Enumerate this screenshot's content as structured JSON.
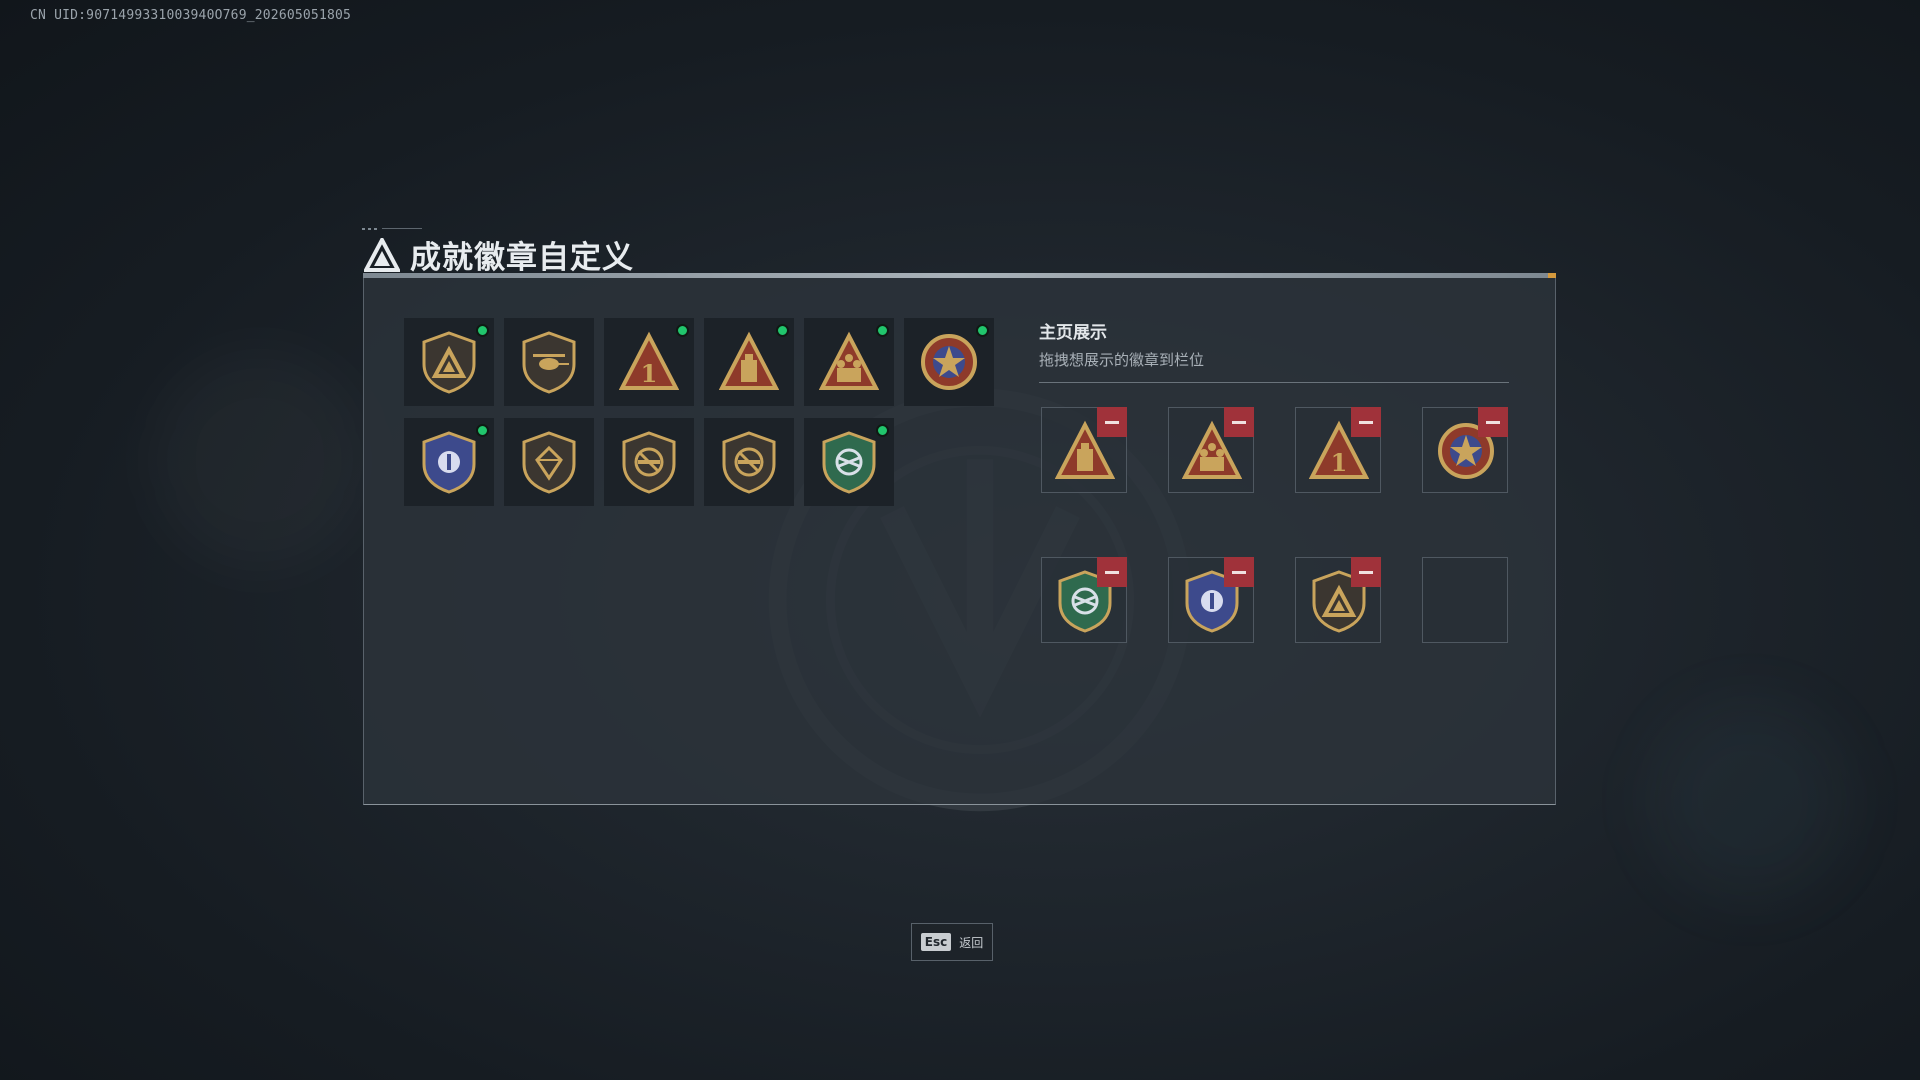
{
  "uid_text": "CN UID:9071499331003940O769_202605051805",
  "header": {
    "title": "成就徽章自定义",
    "logo_icon": "triangle-logo-icon"
  },
  "badges": [
    {
      "icon": "triangle-shield-badge",
      "new": true
    },
    {
      "icon": "helicopter-shield-badge",
      "new": false
    },
    {
      "icon": "number-one-triangle-badge",
      "new": true
    },
    {
      "icon": "tower-triangle-badge",
      "new": true
    },
    {
      "icon": "soldiers-triangle-badge",
      "new": true
    },
    {
      "icon": "star-crest-badge",
      "new": true
    },
    {
      "icon": "blue-winged-shield-badge",
      "new": true
    },
    {
      "icon": "diamond-shield-badge",
      "new": false
    },
    {
      "icon": "no-rifle-shield-badge",
      "new": false
    },
    {
      "icon": "no-pistol-shield-badge",
      "new": false
    },
    {
      "icon": "green-eagle-shield-badge",
      "new": true
    }
  ],
  "showcase": {
    "title": "主页展示",
    "subtitle": "拖拽想展示的徽章到栏位",
    "slots": [
      {
        "icon": "tower-triangle-badge",
        "filled": true
      },
      {
        "icon": "soldiers-triangle-badge",
        "filled": true
      },
      {
        "icon": "number-one-triangle-badge",
        "filled": true
      },
      {
        "icon": "star-crest-badge",
        "filled": true
      },
      {
        "icon": "green-eagle-shield-badge",
        "filled": true
      },
      {
        "icon": "blue-winged-shield-badge",
        "filled": true
      },
      {
        "icon": "triangle-shield-badge",
        "filled": true
      },
      {
        "icon": "",
        "filled": false
      }
    ]
  },
  "esc": {
    "key": "Esc",
    "label": "返回"
  },
  "colors": {
    "new_dot": "#21c66d",
    "remove": "#a0323a",
    "gold": "#c9a45c",
    "red_badge": "#8e3a2a",
    "blue_badge": "#3d4a8c",
    "green_badge": "#2f6a4e"
  }
}
